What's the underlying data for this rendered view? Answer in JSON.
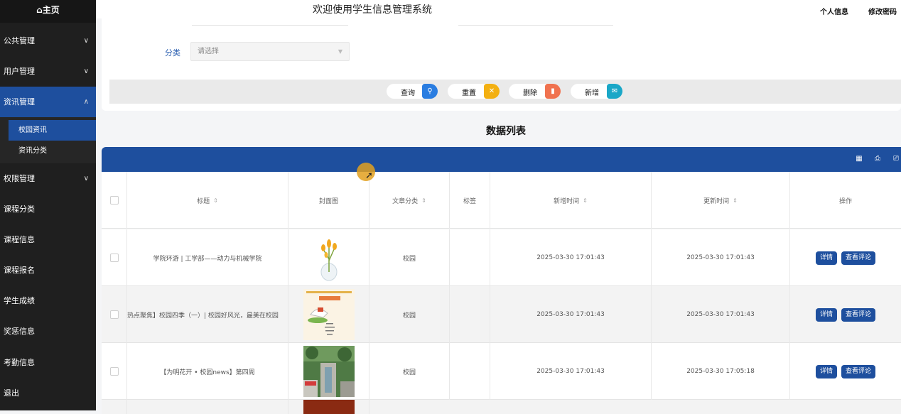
{
  "sidebar": {
    "home": "⌂主页",
    "items": [
      {
        "label": "公共管理",
        "chevron": "∨"
      },
      {
        "label": "用户管理",
        "chevron": "∨"
      },
      {
        "label": "资讯管理",
        "chevron": "∧"
      },
      {
        "label": "权限管理",
        "chevron": "∨"
      },
      {
        "label": "课程分类"
      },
      {
        "label": "课程信息"
      },
      {
        "label": "课程报名"
      },
      {
        "label": "学生成绩"
      },
      {
        "label": "奖惩信息"
      },
      {
        "label": "考勤信息"
      },
      {
        "label": "退出"
      }
    ],
    "subitems": [
      {
        "label": "校园资讯"
      },
      {
        "label": "资讯分类"
      }
    ]
  },
  "header": {
    "title": "欢迎使用学生信息管理系统",
    "profile": "个人信息",
    "change_password": "修改密码"
  },
  "search": {
    "category_label": "分类",
    "category_placeholder": "请选择"
  },
  "actions": {
    "query": "查询",
    "reset": "重置",
    "delete": "删除",
    "add": "新增"
  },
  "colors": {
    "accent": "#1e4f9e",
    "query": "#2a7de1",
    "reset": "#f3b012",
    "delete": "#f0724f",
    "add": "#1aa7c7"
  },
  "list": {
    "title": "数据列表",
    "columns": [
      "标题",
      "封面图",
      "文章分类",
      "标签",
      "新增时间",
      "更新时间",
      "操作"
    ],
    "detail_btn": "详情",
    "comments_btn": "查看评论",
    "rows": [
      {
        "title": "学院环游 | 工学部——动力与机械学院",
        "category": "校园",
        "tag": "",
        "created": "2025-03-30 17:01:43",
        "updated": "2025-03-30 17:01:43"
      },
      {
        "title": "热点聚焦】校园四季（一）| 校园好风光，最美在校园",
        "category": "校园",
        "tag": "",
        "created": "2025-03-30 17:01:43",
        "updated": "2025-03-30 17:01:43"
      },
      {
        "title": "【为明花开 • 校园news】第四周",
        "category": "校园",
        "tag": "",
        "created": "2025-03-30 17:01:43",
        "updated": "2025-03-30 17:05:18"
      }
    ]
  }
}
